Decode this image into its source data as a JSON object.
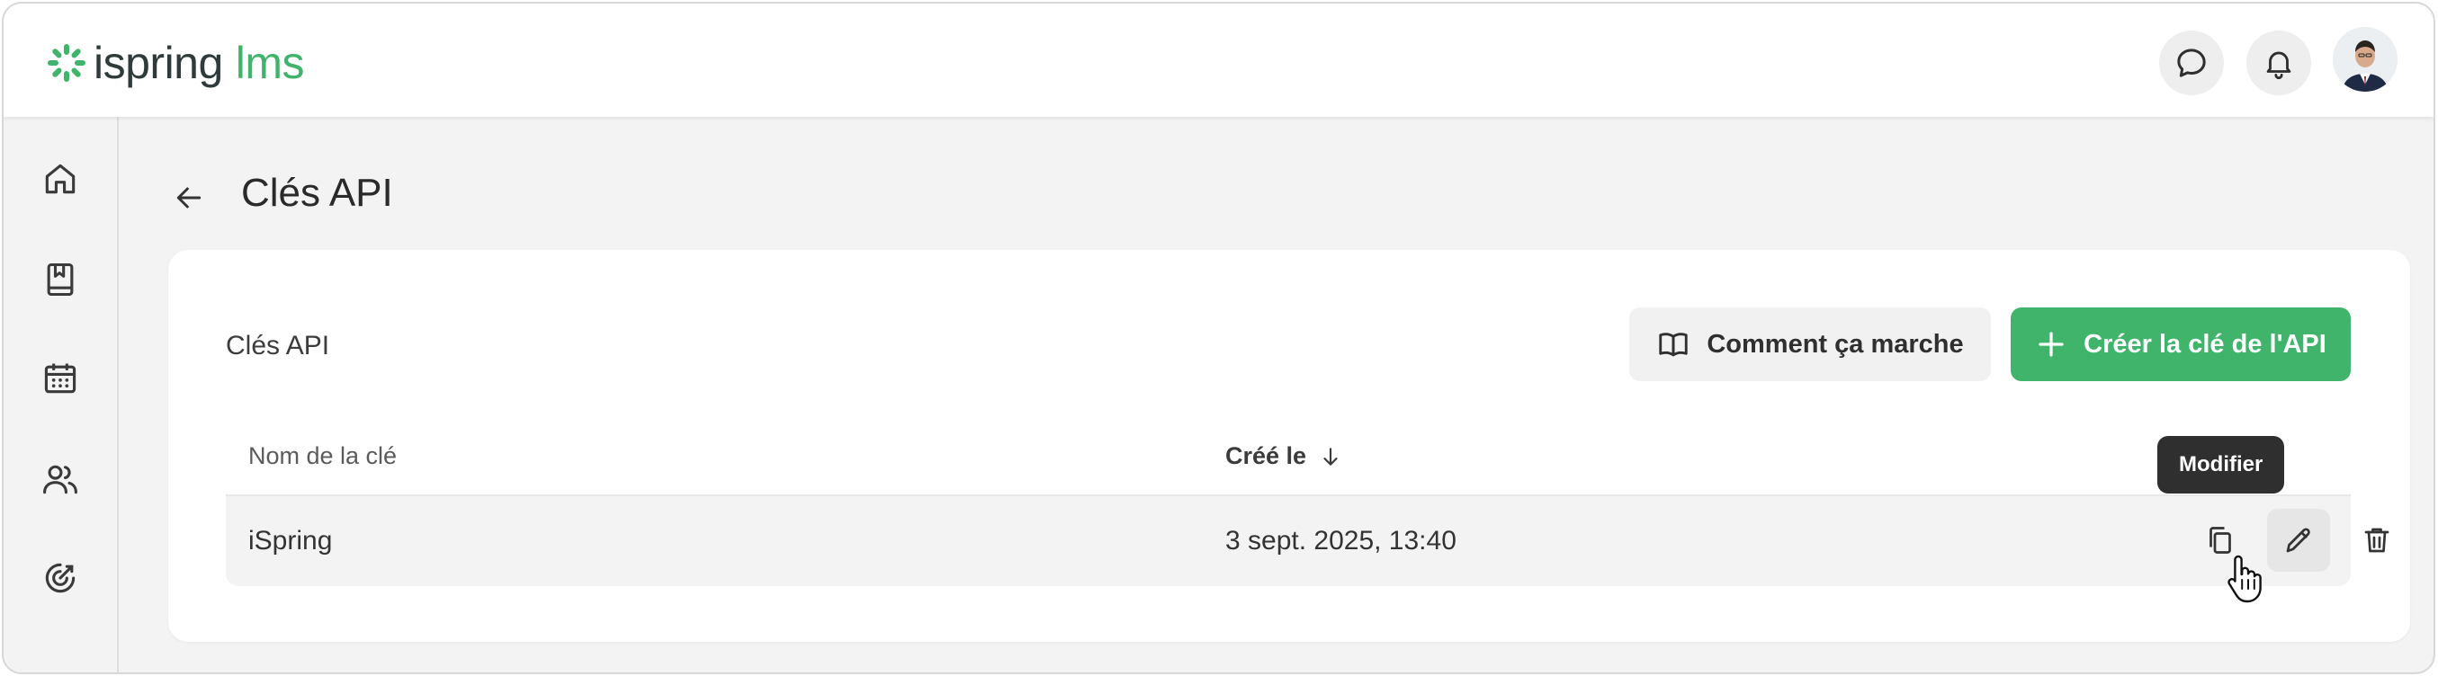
{
  "app": {
    "logo_word": "ispring",
    "logo_word2": "lms",
    "brand_color": "#3fb46a"
  },
  "header": {
    "icons": [
      "chat-icon",
      "bell-icon",
      "user-avatar"
    ]
  },
  "sidebar": {
    "items": [
      {
        "icon": "home-icon"
      },
      {
        "icon": "bookmark-book-icon"
      },
      {
        "icon": "calendar-icon"
      },
      {
        "icon": "users-icon"
      },
      {
        "icon": "target-icon"
      }
    ]
  },
  "page": {
    "title": "Clés API"
  },
  "card": {
    "title": "Clés API",
    "how_it_works_label": "Comment ça marche",
    "create_key_label": "Créer la clé de l'API"
  },
  "table": {
    "columns": [
      "Nom de la clé",
      "Créé le"
    ],
    "sort_column": "Créé le",
    "sort_direction": "descending",
    "rows": [
      {
        "name": "iSpring",
        "created": "3 sept. 2025, 13:40"
      }
    ]
  },
  "tooltip": {
    "text": "Modifier"
  }
}
